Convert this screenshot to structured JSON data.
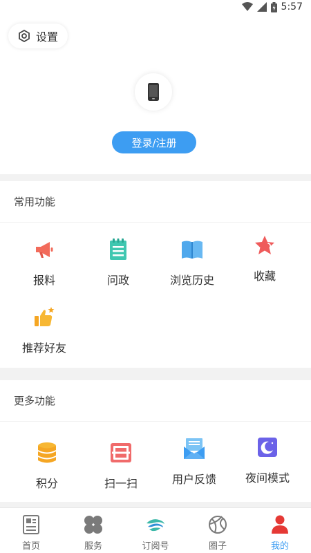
{
  "status_bar": {
    "time": "5:57"
  },
  "header": {
    "settings_label": "设置",
    "login_label": "登录/注册"
  },
  "common": {
    "title": "常用功能",
    "items": [
      {
        "label": "报料",
        "icon": "megaphone-icon"
      },
      {
        "label": "问政",
        "icon": "notepad-icon"
      },
      {
        "label": "浏览历史",
        "icon": "open-book-icon"
      },
      {
        "label": "收藏",
        "icon": "star-icon"
      },
      {
        "label": "推荐好友",
        "icon": "thumbs-up-icon"
      }
    ]
  },
  "more": {
    "title": "更多功能",
    "items": [
      {
        "label": "积分",
        "icon": "coins-icon"
      },
      {
        "label": "扫一扫",
        "icon": "scan-icon"
      },
      {
        "label": "用户反馈",
        "icon": "feedback-envelope-icon"
      },
      {
        "label": "夜间模式",
        "icon": "moon-icon"
      }
    ]
  },
  "tabbar": {
    "tabs": [
      {
        "label": "首页",
        "icon": "newspaper-icon"
      },
      {
        "label": "服务",
        "icon": "clover-icon"
      },
      {
        "label": "订阅号",
        "icon": "subscription-logo-icon"
      },
      {
        "label": "圈子",
        "icon": "circle-icon"
      },
      {
        "label": "我的",
        "icon": "user-icon",
        "active": true
      }
    ]
  },
  "colors": {
    "accent": "#3d9df2"
  }
}
